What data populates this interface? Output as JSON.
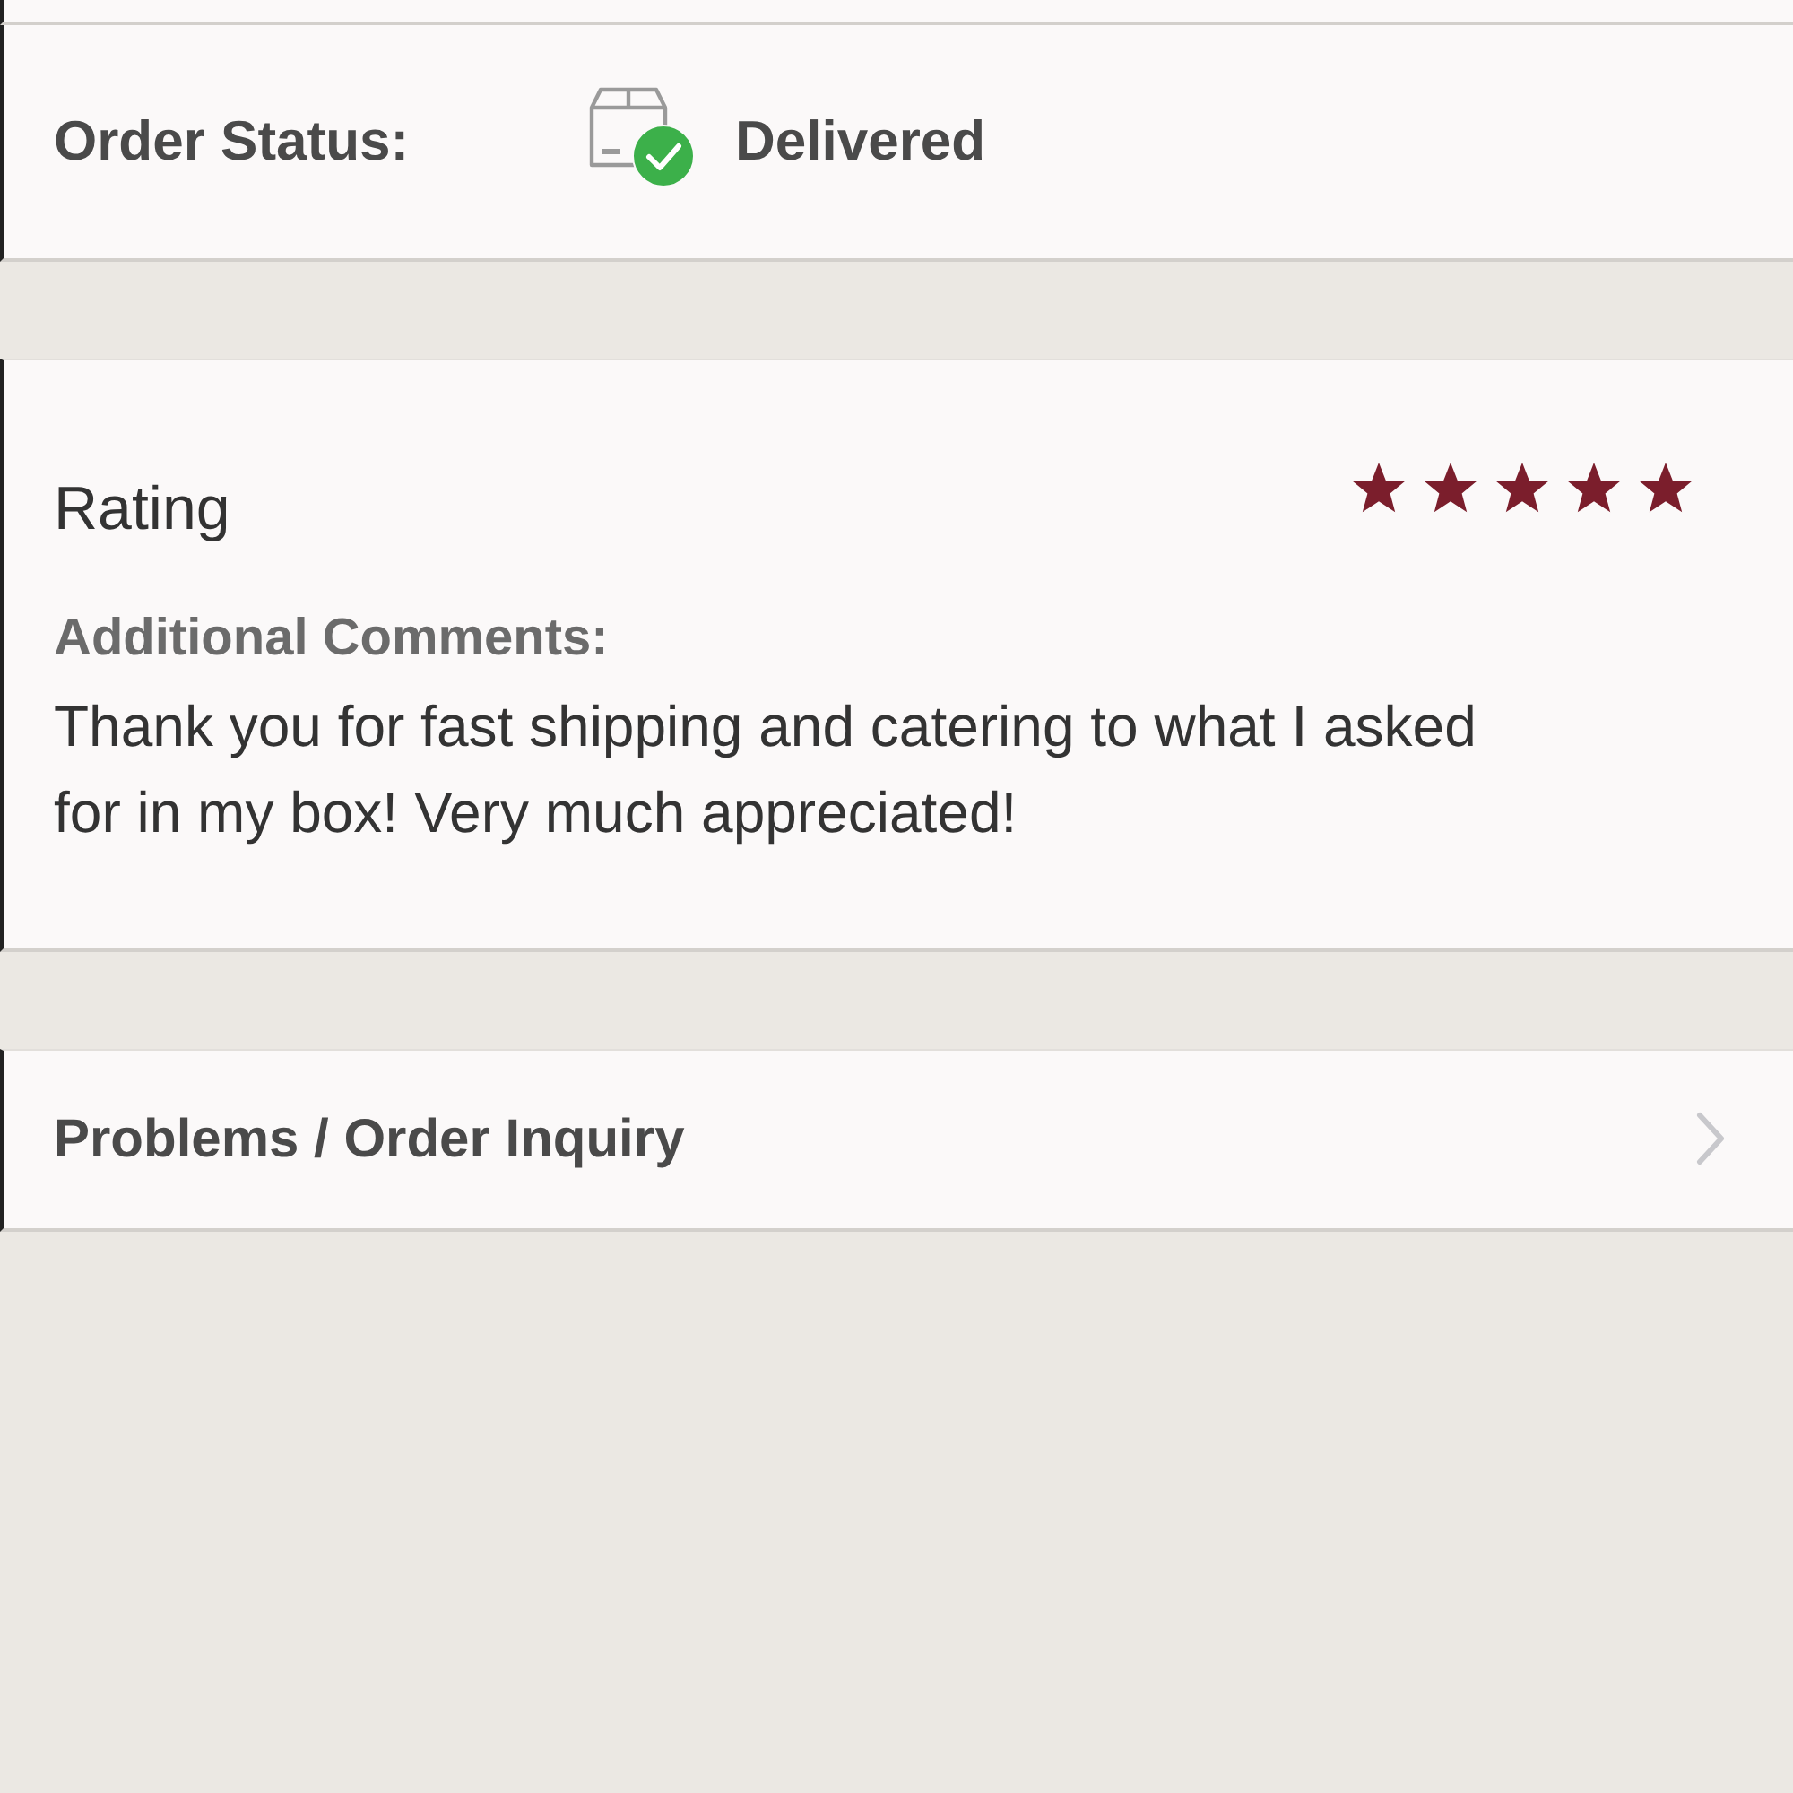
{
  "order_status": {
    "label": "Order Status:",
    "value": "Delivered"
  },
  "rating": {
    "title": "Rating",
    "stars": 5,
    "comments_label": "Additional Comments:",
    "comments": "Thank you for fast shipping and catering to what I asked for in my box! Very much appreciated!"
  },
  "menu_items": [
    {
      "label": "Problems / Order Inquiry"
    }
  ]
}
